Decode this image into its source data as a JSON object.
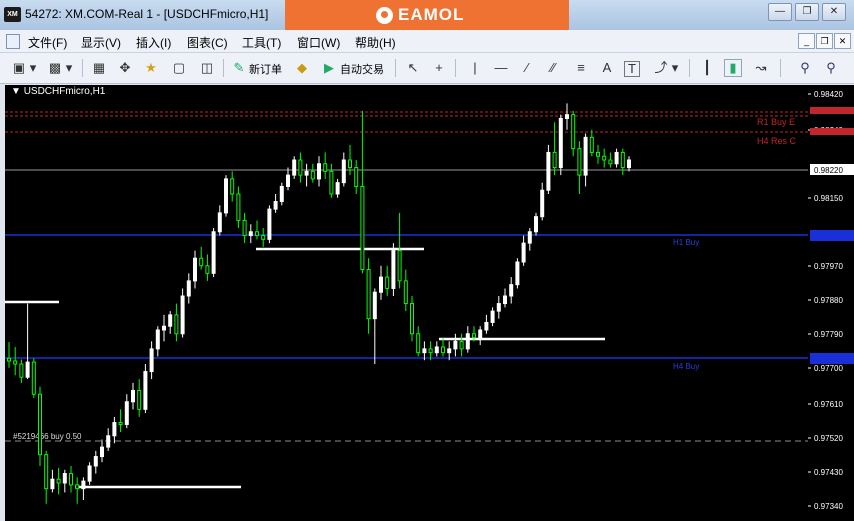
{
  "window": {
    "title": "54272: XM.COM-Real 1 - [USDCHFmicro,H1]",
    "brand": "EAMOL",
    "app_icon": "XM"
  },
  "menu": [
    "文件(F)",
    "显示(V)",
    "插入(I)",
    "图表(C)",
    "工具(T)",
    "窗口(W)",
    "帮助(H)"
  ],
  "toolbar": {
    "new_order": "新订单",
    "auto_trade": "自动交易",
    "text_tool": "A",
    "label_tool": "T"
  },
  "chart": {
    "symbol": "USDCHFmicro,H1",
    "background": "#000000",
    "bull_color": "#ffffff",
    "bear_color": "#00ff00",
    "price_axis": [
      "0.98420",
      "0.98240",
      "0.98150",
      "0.97970",
      "0.97880",
      "0.97790",
      "0.97700",
      "0.97610",
      "0.97520",
      "0.97430",
      "0.97340"
    ],
    "current_price": "0.98220",
    "trade_label": "#5219466 buy 0.50",
    "line_labels": {
      "r1": "R1 Buy E",
      "h4res": "H4 Res C",
      "h1buy": "H1 Buy",
      "h4buy": "H4 Buy"
    }
  }
}
